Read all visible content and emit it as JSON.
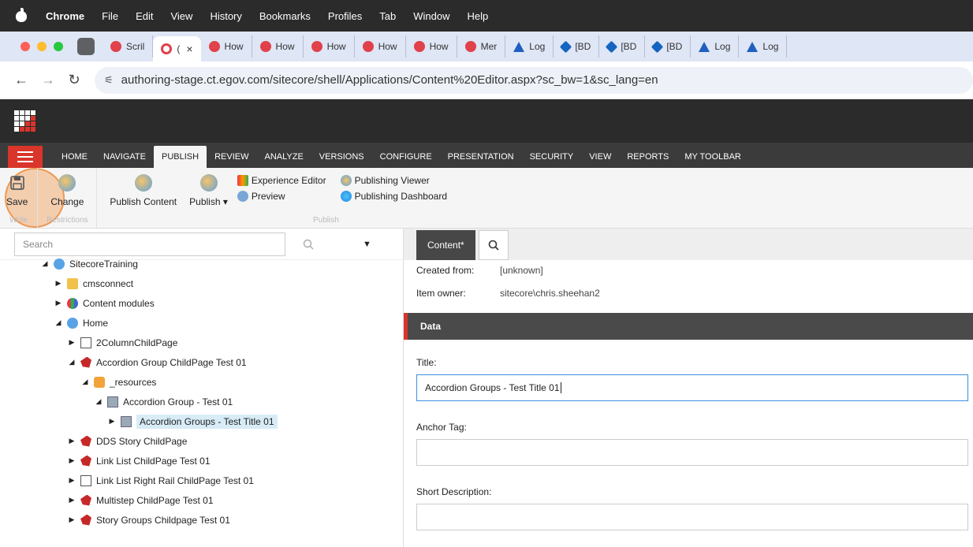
{
  "menubar": {
    "app": "Chrome",
    "items": [
      "File",
      "Edit",
      "View",
      "History",
      "Bookmarks",
      "Profiles",
      "Tab",
      "Window",
      "Help"
    ]
  },
  "tabs": [
    {
      "label": "Scril",
      "icon": "red"
    },
    {
      "label": "(",
      "icon": "redring",
      "active": true
    },
    {
      "label": "How",
      "icon": "red"
    },
    {
      "label": "How",
      "icon": "red"
    },
    {
      "label": "How",
      "icon": "red"
    },
    {
      "label": "How",
      "icon": "red"
    },
    {
      "label": "How",
      "icon": "red"
    },
    {
      "label": "Mer",
      "icon": "red"
    },
    {
      "label": "Log",
      "icon": "tri"
    },
    {
      "label": "[BD",
      "icon": "blue"
    },
    {
      "label": "[BD",
      "icon": "blue"
    },
    {
      "label": "[BD",
      "icon": "blue"
    },
    {
      "label": "Log",
      "icon": "tri"
    },
    {
      "label": "Log",
      "icon": "tri"
    }
  ],
  "address": {
    "url": "authoring-stage.ct.egov.com/sitecore/shell/Applications/Content%20Editor.aspx?sc_bw=1&sc_lang=en"
  },
  "ribbon_tabs": [
    "HOME",
    "NAVIGATE",
    "PUBLISH",
    "REVIEW",
    "ANALYZE",
    "VERSIONS",
    "CONFIGURE",
    "PRESENTATION",
    "SECURITY",
    "VIEW",
    "REPORTS",
    "MY TOOLBAR"
  ],
  "ribbon": {
    "save": "Save",
    "change": "Change",
    "write_group": "Write",
    "restrictions_group": "Restrictions",
    "publish_content": "Publish Content",
    "publish": "Publish",
    "experience_editor": "Experience Editor",
    "preview": "Preview",
    "publishing_viewer": "Publishing Viewer",
    "publishing_dashboard": "Publishing Dashboard",
    "publish_group": "Publish"
  },
  "search": {
    "placeholder": "Search"
  },
  "tree": [
    {
      "label": "SitecoreTraining",
      "indent": 0,
      "arrow": "down",
      "icon": "globe"
    },
    {
      "label": "cmsconnect",
      "indent": 1,
      "arrow": "right",
      "icon": "folder"
    },
    {
      "label": "Content modules",
      "indent": 1,
      "arrow": "right",
      "icon": "multi"
    },
    {
      "label": "Home",
      "indent": 1,
      "arrow": "down",
      "icon": "globe"
    },
    {
      "label": "2ColumnChildPage",
      "indent": 2,
      "arrow": "right",
      "icon": "page"
    },
    {
      "label": "Accordion Group ChildPage Test 01",
      "indent": 2,
      "arrow": "down",
      "icon": "red"
    },
    {
      "label": "_resources",
      "indent": 3,
      "arrow": "down",
      "icon": "cube"
    },
    {
      "label": "Accordion Group - Test 01",
      "indent": 4,
      "arrow": "down",
      "icon": "table"
    },
    {
      "label": "Accordion Groups - Test Title 01",
      "indent": 5,
      "arrow": "right",
      "icon": "table",
      "selected": true
    },
    {
      "label": "DDS Story ChildPage",
      "indent": 2,
      "arrow": "right",
      "icon": "red"
    },
    {
      "label": "Link List ChildPage Test 01",
      "indent": 2,
      "arrow": "right",
      "icon": "red"
    },
    {
      "label": "Link List Right Rail ChildPage Test 01",
      "indent": 2,
      "arrow": "right",
      "icon": "page"
    },
    {
      "label": "Multistep ChildPage Test 01",
      "indent": 2,
      "arrow": "right",
      "icon": "red"
    },
    {
      "label": "Story Groups Childpage Test 01",
      "indent": 2,
      "arrow": "right",
      "icon": "red"
    }
  ],
  "editor": {
    "tab_content": "Content*",
    "created_from_label": "Created from:",
    "created_from_value": "[unknown]",
    "item_owner_label": "Item owner:",
    "item_owner_value": "sitecore\\chris.sheehan2",
    "section_data": "Data",
    "title_label": "Title:",
    "title_value": "Accordion Groups - Test Title 01",
    "anchor_label": "Anchor Tag:",
    "anchor_value": "",
    "short_desc_label": "Short Description:"
  }
}
